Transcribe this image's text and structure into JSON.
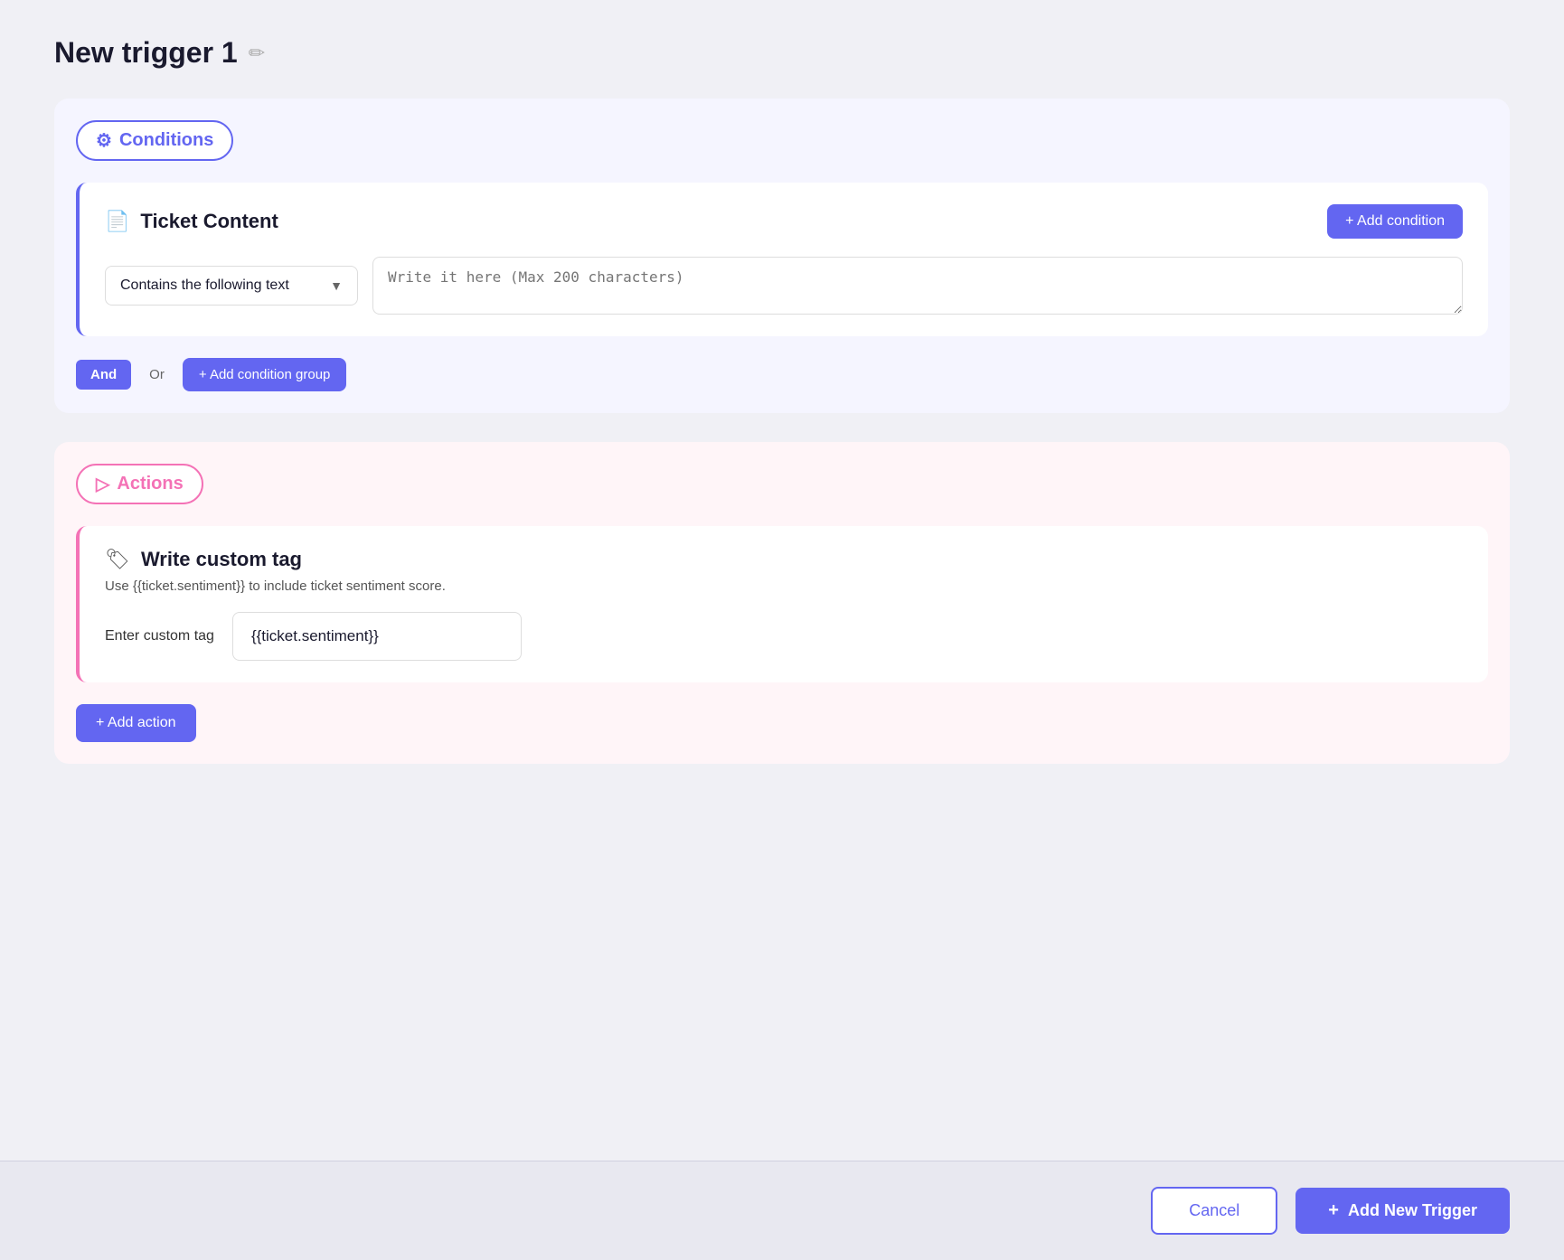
{
  "page": {
    "title": "New trigger 1"
  },
  "conditions": {
    "badge_label": "Conditions",
    "badge_icon": "⚙",
    "card_title": "Ticket Content",
    "card_icon": "📄",
    "add_condition_label": "+ Add condition",
    "condition_select_value": "Contains the following text",
    "condition_text_placeholder": "Write it here (Max 200 characters)",
    "and_label": "And",
    "or_label": "Or",
    "add_group_label": "+ Add condition group"
  },
  "actions": {
    "badge_label": "Actions",
    "badge_icon": "▷",
    "card_title": "Write custom tag",
    "card_icon": "🏷",
    "subtitle": "Use {{ticket.sentiment}} to include ticket sentiment score.",
    "field_label": "Enter custom tag",
    "field_value": "{{ticket.sentiment}}",
    "add_action_label": "+ Add action"
  },
  "footer": {
    "cancel_label": "Cancel",
    "add_trigger_label": "Add New Trigger"
  }
}
